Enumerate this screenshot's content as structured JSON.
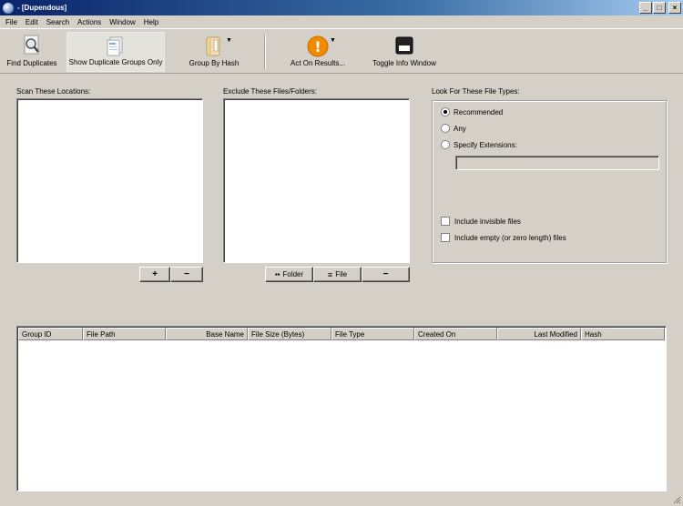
{
  "window": {
    "title": "- [Dupendous]",
    "controls": {
      "minimize": "_",
      "maximize": "□",
      "close": "×"
    }
  },
  "menu": {
    "items": [
      "File",
      "Edit",
      "Search",
      "Actions",
      "Window",
      "Help"
    ]
  },
  "toolbar": {
    "find_duplicates": "Find Duplicates",
    "show_groups": "Show Duplicate Groups Only",
    "group_by_hash": "Group By Hash",
    "act_on_results": "Act On Results...",
    "toggle_info": "Toggle Info Window",
    "act_icon_glyph": "!"
  },
  "scan": {
    "label": "Scan These Locations:",
    "add": "+",
    "remove": "−"
  },
  "exclude": {
    "label": "Exclude These Files/Folders:",
    "folder": "Folder",
    "file": "File",
    "remove": "−"
  },
  "filetypes": {
    "label": "Look For These File Types:",
    "recommended": "Recommended",
    "any": "Any",
    "specify": "Specify Extensions:",
    "extensions_value": "",
    "include_invisible": "Include invisible files",
    "include_empty": "Include empty (or zero length) files",
    "selected": "recommended"
  },
  "results": {
    "columns": [
      "Group ID",
      "File Path",
      "Base Name",
      "File Size (Bytes)",
      "File Type",
      "Created On",
      "Last Modified",
      "Hash"
    ],
    "rows": []
  },
  "colors": {
    "titlebar_start": "#0a246a",
    "titlebar_end": "#a6caf0",
    "face": "#d4d0c8",
    "act_icon": "#f28a00"
  }
}
